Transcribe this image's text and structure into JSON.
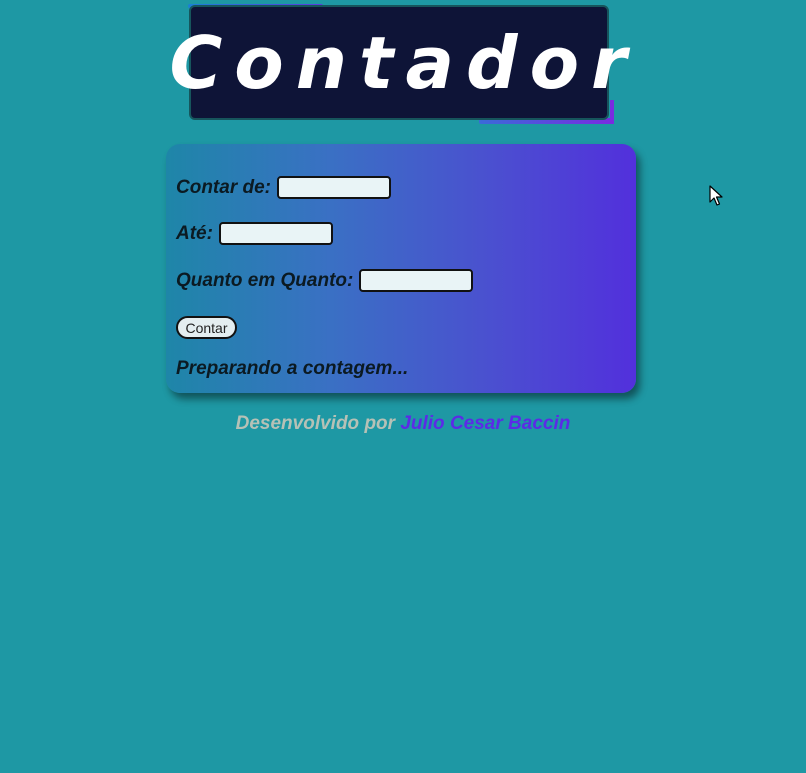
{
  "header": {
    "title": "Contador"
  },
  "form": {
    "from_label": "Contar de:",
    "from_value": "",
    "to_label": "Até:",
    "to_value": "",
    "step_label": "Quanto em Quanto:",
    "step_value": "",
    "count_button": "Contar",
    "status": "Preparando a contagem..."
  },
  "footer": {
    "prefix": "Desenvolvido por",
    "author": "Julio Cesar Baccin"
  },
  "colors": {
    "background": "#1e98a4",
    "header_bg": "#0e1437",
    "card_gradient_start": "#1e86a8",
    "card_gradient_end": "#5230dc",
    "author_link": "#5b2be6"
  },
  "icons": {
    "cursor": "mouse-pointer-icon"
  }
}
